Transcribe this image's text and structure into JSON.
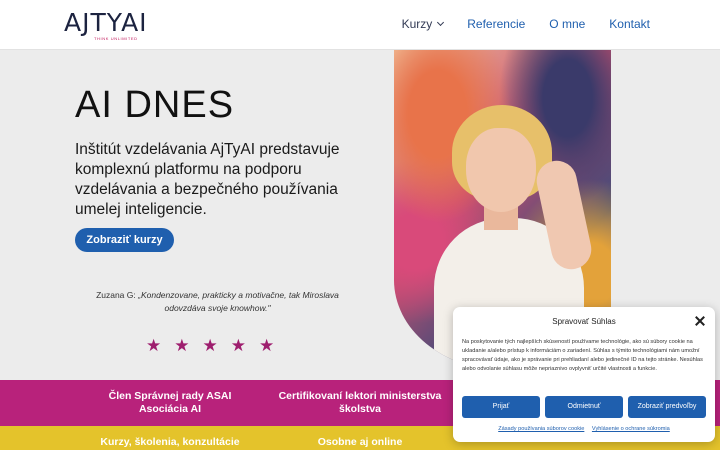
{
  "header": {
    "logo_text": "AJTYAI",
    "logo_tagline": "THINK UNLIMITED",
    "nav": [
      {
        "label": "Kurzy"
      },
      {
        "label": "Referencie"
      },
      {
        "label": "O mne"
      },
      {
        "label": "Kontakt"
      }
    ]
  },
  "hero": {
    "title": "AI DNES",
    "text": "Inštitút vzdelávania AjTyAI predstavuje komplexnú platformu na podporu vzdelávania a bezpečného používania umelej inteligencie.",
    "cta_label": "Zobraziť kurzy",
    "quote_author": "Zuzana G: ",
    "quote_text": "„Kondenzovane, prakticky a motivačne, tak Miroslava odovzdáva svoje knowhow.\"",
    "rating": 5
  },
  "cookie": {
    "title": "Spravovať Súhlas",
    "text": "Na poskytovanie tých najlepších skúseností používame technológie, ako sú súbory cookie na ukladanie a/alebo prístup k informáciám o zariadení. Súhlas s týmito technológiami nám umožní spracovávať údaje, ako je správanie pri prehliadaní alebo jedinečné ID na tejto stránke. Nesúhlas alebo odvolanie súhlasu môže nepriaznivo ovplyvniť určité vlastnosti a funkcie.",
    "btn_accept": "Prijať",
    "btn_deny": "Odmietnuť",
    "btn_prefs": "Zobraziť predvoľby",
    "link_cookie_policy": "Zásady používania súborov cookie",
    "link_privacy": "Vyhlásenie o ochrane súkromia"
  },
  "bands": {
    "purple": [
      "Člen Správnej rady ASAI Asociácia AI",
      "Certifikovaní lektori ministerstva školstva"
    ],
    "yellow": [
      "Kurzy, školenia, konzultácie",
      "Osobne aj online"
    ]
  },
  "colors": {
    "primary": "#1f5fae",
    "purple": "#b8227b",
    "yellow": "#e4c32b",
    "star": "#9e1e6e"
  }
}
